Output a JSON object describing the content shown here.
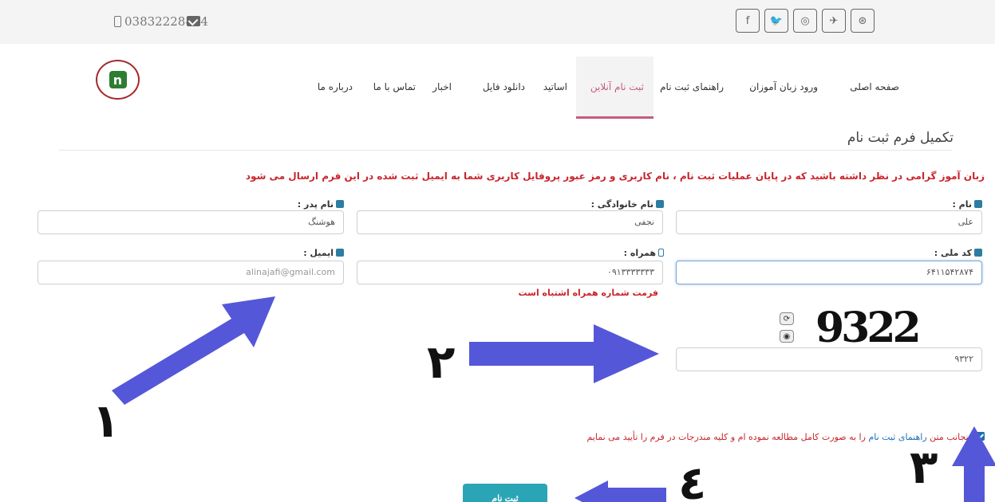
{
  "topbar": {
    "phone": "03832228814",
    "social_icons": [
      "facebook-icon",
      "twitter-icon",
      "instagram-icon",
      "telegram-icon",
      "dribbble-icon"
    ],
    "social_glyphs": [
      "f",
      "🐦",
      "◎",
      "✈",
      "⊛"
    ]
  },
  "nav": {
    "items": [
      "صفحه اصلی",
      "ورود زبان آموزان",
      "راهنمای ثبت نام",
      "ثبت نام آنلاین",
      "اساتید",
      "دانلود فایل",
      "اخبار",
      "تماس با ما",
      "درباره ما"
    ],
    "active": "ثبت نام آنلاین"
  },
  "page": {
    "title": "تکمیل فرم ثبت نام",
    "notice": "زبان آموز گرامی در نظر داشته باشید که در پایان عملیات ثبت نام ، نام کاربری و رمز عبور پروفایل کاربری شما به ایمیل ثبت شده در این فرم ارسال می شود"
  },
  "form": {
    "first_name": {
      "label": "نام :",
      "value": "علی"
    },
    "last_name": {
      "label": "نام خانوادگی :",
      "value": "نجفی"
    },
    "father_name": {
      "label": "نام پدر :",
      "value": "هوشنگ"
    },
    "national_code": {
      "label": "کد ملی :",
      "value": "۶۴۱۱۵۴۲۸۷۴"
    },
    "mobile": {
      "label": "همراه :",
      "value": "۰۹۱۳۳۳۳۳۳۳",
      "error": "فرمت شماره همراه اشتباه است"
    },
    "email": {
      "label": "ایمیل :",
      "value": "alinajafi@gmail.com"
    },
    "captcha_image_text": "9322",
    "captcha_value": "۹۳۲۲",
    "agree_prefix": "اینجانب متن",
    "agree_link": "راهنمای ثبت نام",
    "agree_suffix": "را به صورت کامل مطالعه نموده ام و کلیه مندرجات در فرم را تأیید می نمایم",
    "submit_label": "ثبت نام"
  },
  "annotations": {
    "numbers": [
      "۱",
      "۲",
      "۳",
      "٤"
    ],
    "arrow_color": "#5557d9"
  }
}
